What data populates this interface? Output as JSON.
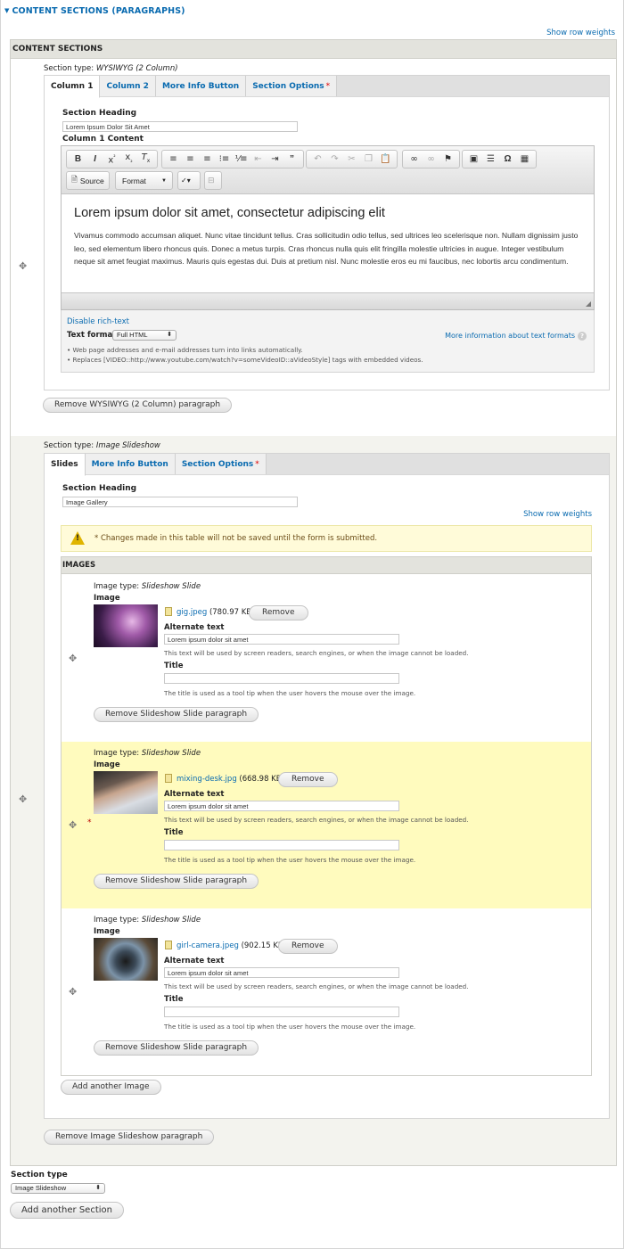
{
  "fieldset": {
    "legend": "CONTENT SECTIONS (PARAGRAPHS)",
    "show_row_weights": "Show row weights",
    "table_header": "CONTENT SECTIONS"
  },
  "section1": {
    "type_label": "Section type:",
    "type_value": "WYSIWYG (2 Column)",
    "tabs": [
      {
        "label": "Column 1",
        "active": true,
        "required": false
      },
      {
        "label": "Column 2",
        "active": false,
        "required": false
      },
      {
        "label": "More Info Button",
        "active": false,
        "required": false
      },
      {
        "label": "Section Options",
        "active": false,
        "required": true
      }
    ],
    "heading_label": "Section Heading",
    "heading_value": "Lorem Ipsum Dolor Sit Amet",
    "content_label": "Column 1 Content",
    "editor": {
      "toolbar_row1": [
        "bold",
        "italic",
        "superscript",
        "subscript",
        "remove-format",
        "align-left",
        "align-center",
        "align-right",
        "bulleted-list",
        "numbered-list",
        "outdent",
        "indent",
        "blockquote",
        "undo",
        "redo",
        "cut",
        "copy",
        "paste-text",
        "link",
        "unlink",
        "anchor",
        "image",
        "horizontal-rule",
        "special-char",
        "table"
      ],
      "source_label": "Source",
      "format_label": "Format",
      "heading": "Lorem ipsum dolor sit amet, consectetur adipiscing elit",
      "body": "Vivamus commodo accumsan aliquet. Nunc vitae tincidunt tellus. Cras sollicitudin odio tellus, sed ultrices leo scelerisque non. Nullam dignissim justo leo, sed elementum libero rhoncus quis. Donec a metus turpis. Cras rhoncus nulla quis elit fringilla molestie ultricies in augue. Integer vestibulum neque sit amet feugiat maximus. Mauris quis egestas dui. Duis at pretium nisl. Nunc molestie eros eu mi faucibus, nec lobortis arcu condimentum."
    },
    "disable_rich_text": "Disable rich-text",
    "text_format_label": "Text format",
    "text_format_value": "Full HTML",
    "more_info_formats": "More information about text formats",
    "format_tips": [
      "Web page addresses and e-mail addresses turn into links automatically.",
      "Replaces [VIDEO::http://www.youtube.com/watch?v=someVideoID::aVideoStyle] tags with embedded videos."
    ],
    "remove_button": "Remove WYSIWYG (2 Column) paragraph"
  },
  "section2": {
    "type_label": "Section type:",
    "type_value": "Image Slideshow",
    "tabs": [
      {
        "label": "Slides",
        "active": true,
        "required": false
      },
      {
        "label": "More Info Button",
        "active": false,
        "required": false
      },
      {
        "label": "Section Options",
        "active": false,
        "required": true
      }
    ],
    "heading_label": "Section Heading",
    "heading_value": "Image Gallery",
    "show_row_weights": "Show row weights",
    "warning": "* Changes made in this table will not be saved until the form is submitted.",
    "images_header": "IMAGES",
    "slides": [
      {
        "type_label": "Image type:",
        "type_value": "Slideshow Slide",
        "image_label": "Image",
        "filename": "gig.jpeg",
        "size": "(780.97 KB)",
        "remove_label": "Remove",
        "alt_label": "Alternate text",
        "alt_value": "Lorem ipsum dolor sit amet",
        "alt_help": "This text will be used by screen readers, search engines, or when the image cannot be loaded.",
        "title_label": "Title",
        "title_value": "",
        "title_help": "The title is used as a tool tip when the user hovers the mouse over the image.",
        "remove_paragraph": "Remove Slideshow Slide paragraph",
        "changed": false
      },
      {
        "type_label": "Image type:",
        "type_value": "Slideshow Slide",
        "image_label": "Image",
        "filename": "mixing-desk.jpg",
        "size": "(668.98 KB)",
        "remove_label": "Remove",
        "alt_label": "Alternate text",
        "alt_value": "Lorem ipsum dolor sit amet",
        "alt_help": "This text will be used by screen readers, search engines, or when the image cannot be loaded.",
        "title_label": "Title",
        "title_value": "",
        "title_help": "The title is used as a tool tip when the user hovers the mouse over the image.",
        "remove_paragraph": "Remove Slideshow Slide paragraph",
        "changed": true
      },
      {
        "type_label": "Image type:",
        "type_value": "Slideshow Slide",
        "image_label": "Image",
        "filename": "girl-camera.jpeg",
        "size": "(902.15 KB)",
        "remove_label": "Remove",
        "alt_label": "Alternate text",
        "alt_value": "Lorem ipsum dolor sit amet",
        "alt_help": "This text will be used by screen readers, search engines, or when the image cannot be loaded.",
        "title_label": "Title",
        "title_value": "",
        "title_help": "The title is used as a tool tip when the user hovers the mouse over the image.",
        "remove_paragraph": "Remove Slideshow Slide paragraph",
        "changed": false
      }
    ],
    "changed_marker": "*",
    "add_image": "Add another Image",
    "remove_button": "Remove Image Slideshow paragraph"
  },
  "footer": {
    "section_type_label": "Section type",
    "section_type_value": "Image Slideshow",
    "add_section": "Add another Section"
  },
  "icons": {
    "drag": "✥",
    "select_arrows": "⬍",
    "warning": "!"
  },
  "colors": {
    "link": "#0a6bb0",
    "required": "#dd0000",
    "changed_row": "#fffbbe",
    "warning_bg": "#fffbd9"
  }
}
